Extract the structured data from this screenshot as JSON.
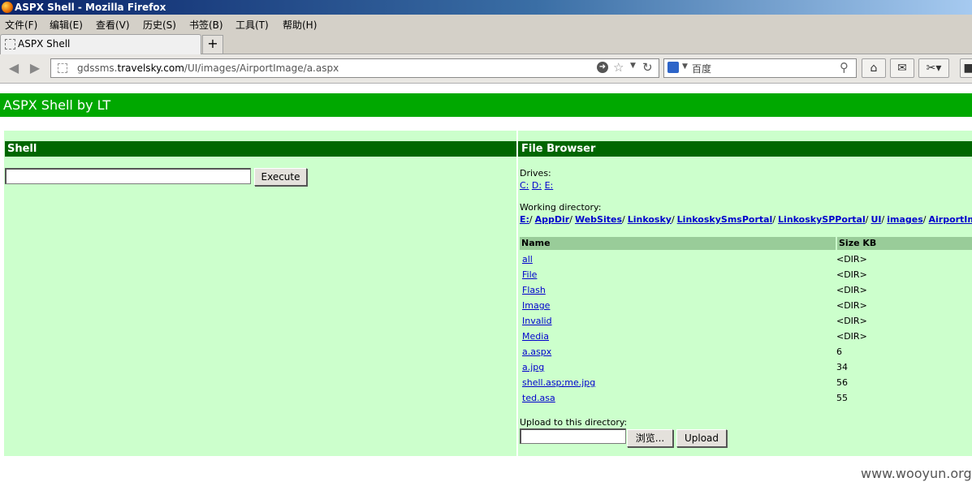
{
  "window": {
    "title": "ASPX Shell - Mozilla Firefox"
  },
  "menu": [
    "文件(F)",
    "编辑(E)",
    "查看(V)",
    "历史(S)",
    "书签(B)",
    "工具(T)",
    "帮助(H)"
  ],
  "tab": {
    "label": "ASPX Shell",
    "new_tab": "+"
  },
  "nav": {
    "url_prefix": "gdssms.",
    "url_domain": "travelsky.com",
    "url_path": "/UI/images/AirportImage/a.aspx",
    "search_placeholder": "百度"
  },
  "page": {
    "header": "ASPX Shell by LT",
    "shell": {
      "title": "Shell",
      "command_value": "",
      "execute_label": "Execute"
    },
    "browser": {
      "title": "File Browser",
      "drives_label": "Drives:",
      "drives": [
        "C:",
        "D:",
        "E:"
      ],
      "working_label": "Working directory:",
      "path": [
        "E:",
        "AppDir",
        "WebSites",
        "Linkosky",
        "LinkoskySmsPortal",
        "LinkoskySPPortal",
        "UI",
        "images",
        "AirportImage"
      ],
      "col_name": "Name",
      "col_size": "Size KB",
      "files": [
        {
          "name": "all",
          "size": "<DIR>"
        },
        {
          "name": "File",
          "size": "<DIR>"
        },
        {
          "name": "Flash",
          "size": "<DIR>"
        },
        {
          "name": "Image",
          "size": "<DIR>"
        },
        {
          "name": "Invalid",
          "size": "<DIR>"
        },
        {
          "name": "Media",
          "size": "<DIR>"
        },
        {
          "name": "a.aspx",
          "size": "6"
        },
        {
          "name": "a.jpg",
          "size": "34"
        },
        {
          "name": "shell.asp;me.jpg",
          "size": "56"
        },
        {
          "name": "ted.asa",
          "size": "55"
        }
      ],
      "upload_label": "Upload to this directory:",
      "browse_label": "浏览...",
      "upload_button": "Upload"
    }
  },
  "watermark": "www.wooyun.org"
}
